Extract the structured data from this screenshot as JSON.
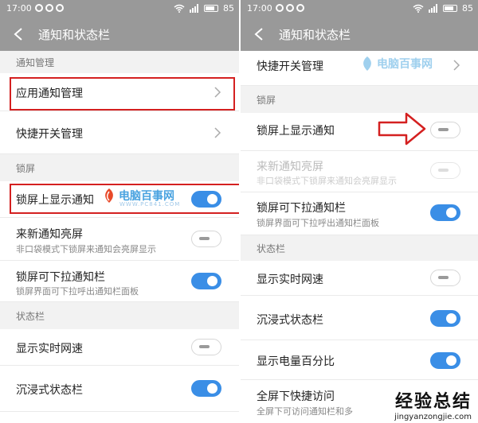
{
  "status_bar": {
    "time": "17:00",
    "battery": "85"
  },
  "title": "通知和状态栏",
  "left": {
    "sections": {
      "notify_manage": "通知管理",
      "lock_screen": "锁屏",
      "status_bar": "状态栏"
    },
    "rows": {
      "app_notify": {
        "label": "应用通知管理"
      },
      "quick_switch": {
        "label": "快捷开关管理"
      },
      "lock_show": {
        "label": "锁屏上显示通知",
        "on": true
      },
      "new_notify_wake": {
        "label": "来新通知亮屏",
        "sub": "非口袋模式下锁屏来通知会亮屏显示",
        "on": false
      },
      "lock_pulldown": {
        "label": "锁屏可下拉通知栏",
        "sub": "锁屏界面可下拉呼出通知栏面板",
        "on": true
      },
      "net_speed": {
        "label": "显示实时网速",
        "on": false
      },
      "immersive": {
        "label": "沉浸式状态栏",
        "on": true
      }
    }
  },
  "right": {
    "sections": {
      "lock_screen": "锁屏",
      "status_bar": "状态栏"
    },
    "rows": {
      "quick_switch": {
        "label": "快捷开关管理"
      },
      "lock_show": {
        "label": "锁屏上显示通知",
        "on": false
      },
      "new_notify_wake": {
        "label": "来新通知亮屏",
        "sub": "非口袋模式下锁屏来通知会亮屏显示",
        "on": false,
        "disabled": true
      },
      "lock_pulldown": {
        "label": "锁屏可下拉通知栏",
        "sub": "锁屏界面可下拉呼出通知栏面板",
        "on": true
      },
      "net_speed": {
        "label": "显示实时网速",
        "on": false
      },
      "immersive": {
        "label": "沉浸式状态栏",
        "on": true
      },
      "battery_pct": {
        "label": "显示电量百分比",
        "on": true
      },
      "fullscreen_quick": {
        "label": "全屏下快捷访问",
        "sub": "全屏下可访问通知栏和多"
      }
    }
  },
  "watermark": {
    "brand": "电脑百事网",
    "brand_url": "WWW.PC841.COM",
    "corner_title": "经验总结",
    "corner_url": "jingyanzongjie.com"
  },
  "colors": {
    "accent": "#3a8ee6",
    "highlight": "#d42020",
    "header": "#999999"
  }
}
